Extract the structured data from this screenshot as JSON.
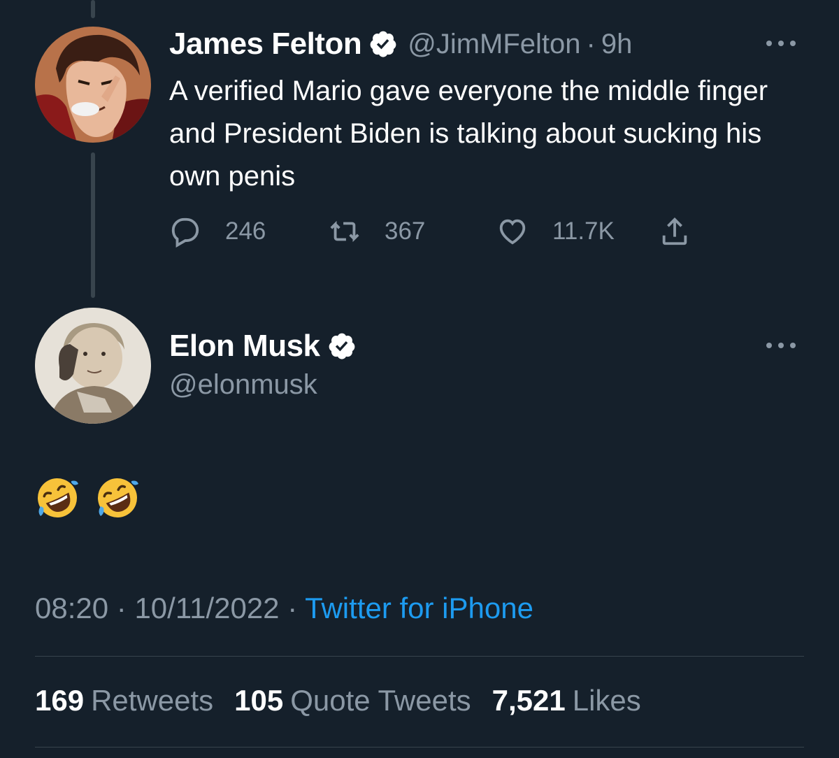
{
  "colors": {
    "background": "#15202b",
    "primary_text": "#ffffff",
    "secondary_text": "#8b98a5",
    "link": "#1d9bf0",
    "divider": "#38444d"
  },
  "parent_tweet": {
    "display_name": "James Felton",
    "handle": "@JimMFelton",
    "separator": "·",
    "time_ago": "9h",
    "text": "A verified Mario gave everyone the middle finger and President Biden is talking about sucking his own penis",
    "reply_count": "246",
    "retweet_count": "367",
    "like_count": "11.7K",
    "icons": [
      "reply-icon",
      "retweet-icon",
      "like-icon",
      "share-icon",
      "more-icon",
      "verified-badge-icon"
    ]
  },
  "reply_tweet": {
    "display_name": "Elon Musk",
    "handle": "@elonmusk",
    "content_emoji": [
      "rolling-on-floor-laughing-emoji",
      "rolling-on-floor-laughing-emoji"
    ],
    "time": "08:20",
    "separator": "·",
    "date": "10/11/2022",
    "source": "Twitter for iPhone"
  },
  "stats": {
    "retweets_num": "169",
    "retweets_label": "Retweets",
    "quotes_num": "105",
    "quotes_label": "Quote Tweets",
    "likes_num": "7,521",
    "likes_label": "Likes"
  }
}
